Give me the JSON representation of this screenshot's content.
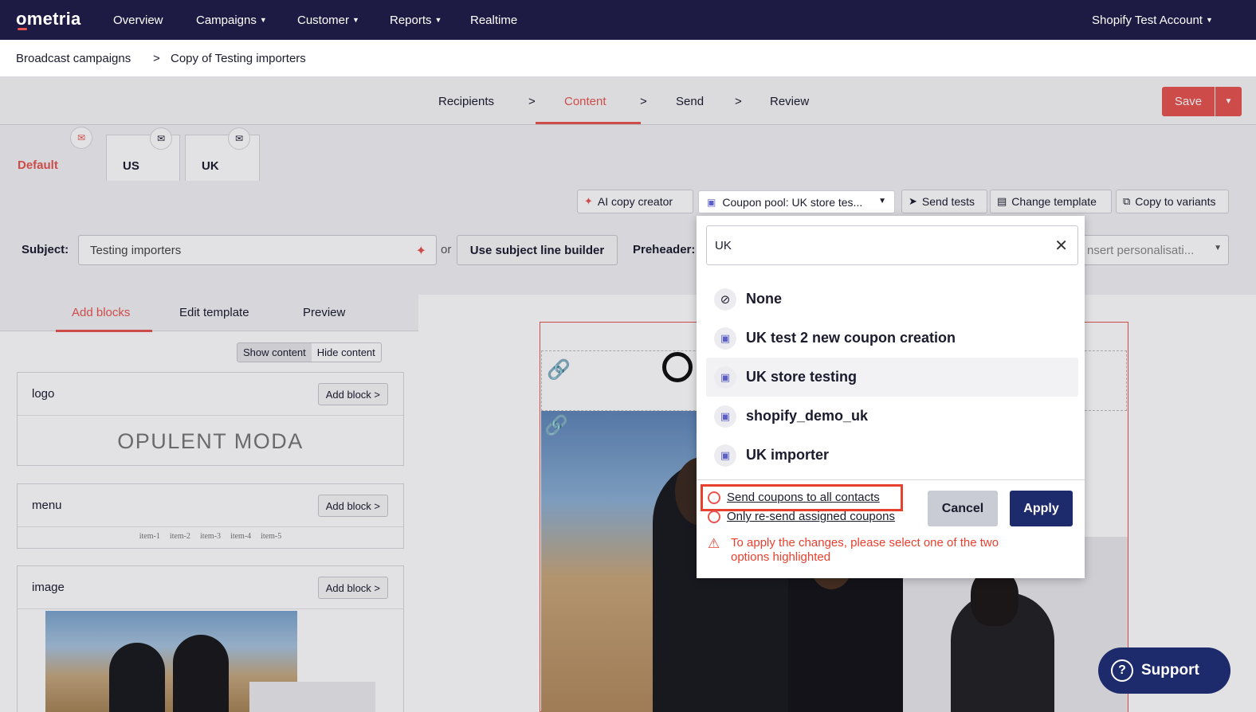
{
  "app": {
    "logo": "ometria",
    "account": "Shopify Test Account"
  },
  "nav": {
    "items": [
      "Overview",
      "Campaigns",
      "Customer",
      "Reports",
      "Realtime"
    ]
  },
  "breadcrumb": {
    "parent": "Broadcast campaigns",
    "sep": ">",
    "current": "Copy of Testing importers"
  },
  "steps": {
    "items": [
      "Recipients",
      "Content",
      "Send",
      "Review"
    ],
    "sep": ">",
    "active": "Content"
  },
  "save": {
    "label": "Save"
  },
  "variants": {
    "tabs": [
      "Default",
      "US",
      "UK"
    ],
    "active": "Default"
  },
  "toolbar": {
    "ai_copy": "AI copy creator",
    "coupon_pool": "Coupon pool: UK store tes...",
    "send_tests": "Send tests",
    "change_template": "Change template",
    "copy_variants": "Copy to variants"
  },
  "subject": {
    "label": "Subject:",
    "value": "Testing importers",
    "or": "or",
    "builder_button": "Use subject line builder",
    "preheader_label": "Preheader:",
    "preheader_placeholder": "nsert personalisati..."
  },
  "left_panel": {
    "tabs": [
      "Add blocks",
      "Edit template",
      "Preview"
    ],
    "active_tab": "Add blocks",
    "show_content": "Show content",
    "hide_content": "Hide content",
    "add_block": "Add block >",
    "blocks": [
      {
        "name": "logo",
        "preview": "OPULENT MODA"
      },
      {
        "name": "menu",
        "items": [
          "item-1",
          "item-2",
          "item-3",
          "item-4",
          "item-5"
        ]
      },
      {
        "name": "image"
      }
    ]
  },
  "coupon_popup": {
    "search_value": "UK",
    "options": [
      "None",
      "UK test 2 new coupon creation",
      "UK store testing",
      "shopify_demo_uk",
      "UK importer"
    ],
    "selected": "UK store testing",
    "radio_all": "Send coupons to all contacts",
    "radio_resend": "Only re-send assigned coupons",
    "cancel": "Cancel",
    "apply": "Apply",
    "warning": "To apply the changes, please select one of the two options highlighted"
  },
  "support": {
    "label": "Support"
  },
  "colors": {
    "accent": "#e8554f",
    "nav_bg": "#1d1b44",
    "primary": "#1d2a6b",
    "warning": "#e8402f"
  }
}
